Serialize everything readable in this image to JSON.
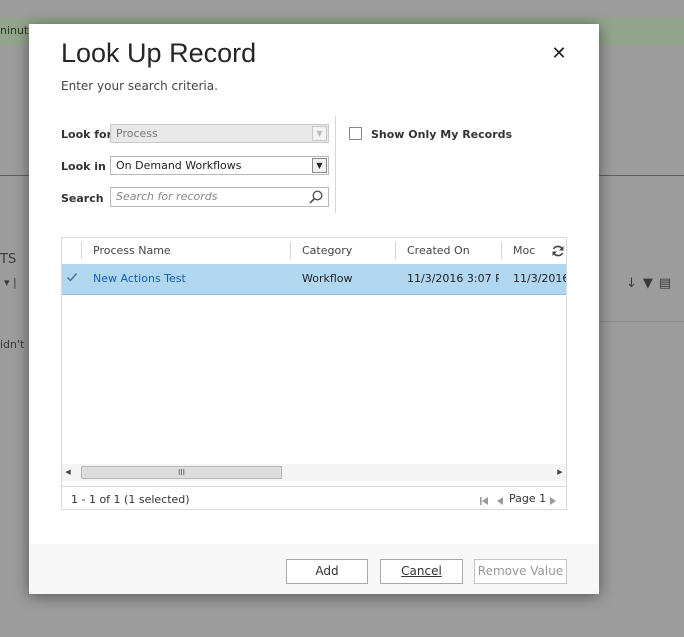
{
  "background": {
    "notice_text": "ninut",
    "section_text": "TS",
    "row_text": "idn't"
  },
  "dialog": {
    "title": "Look Up Record",
    "subtitle": "Enter your search criteria.",
    "close_glyph": "✕"
  },
  "form": {
    "look_for_label": "Look for",
    "look_for_value": "Process",
    "look_in_label": "Look in",
    "look_in_value": "On Demand Workflows",
    "search_label": "Search",
    "search_placeholder": "Search for records",
    "show_only_my_records_label": "Show Only My Records",
    "show_only_my_records_checked": false
  },
  "grid": {
    "columns": [
      "Process Name",
      "Category",
      "Created On",
      "Moc"
    ],
    "rows": [
      {
        "selected": true,
        "process_name": "New Actions Test",
        "category": "Workflow",
        "created_on": "11/3/2016 3:07 P...",
        "modified_on": "11/3/2016"
      }
    ],
    "scroll_thumb_glyph": "III",
    "record_count": "1 - 1 of 1 (1 selected)",
    "page_label": "Page 1"
  },
  "buttons": {
    "add": "Add",
    "cancel": "Cancel",
    "remove": "Remove Value"
  },
  "colors": {
    "selected_row": "#b1d6f0",
    "link": "#1160b7",
    "overlay": "#8c8c8c"
  }
}
